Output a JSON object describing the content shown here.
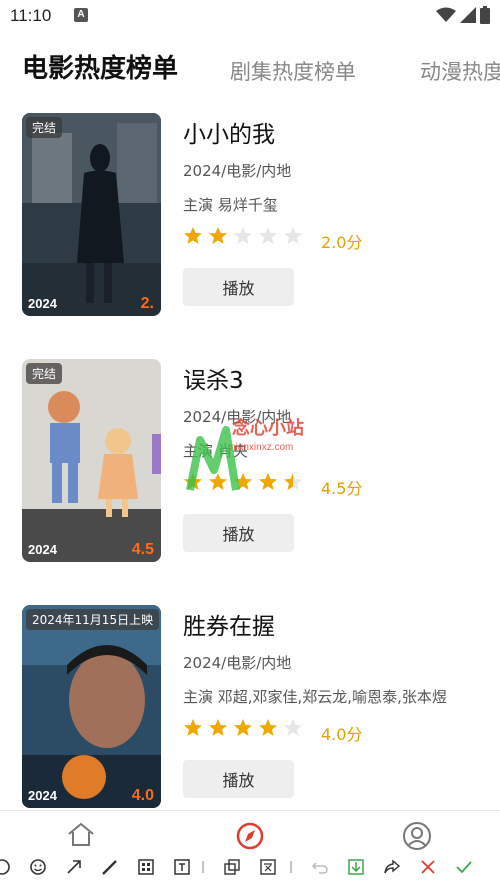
{
  "status_bar": {
    "time": "11:10",
    "badge": "A"
  },
  "tabs": [
    {
      "label": "电影热度榜单",
      "active": true
    },
    {
      "label": "剧集热度榜单",
      "active": false
    },
    {
      "label": "动漫热度",
      "active": false
    }
  ],
  "movies": [
    {
      "badge": "完结",
      "year": "2024",
      "score_mark": "2.",
      "title": "小小的我",
      "meta": "2024/电影/内地",
      "cast": "主演 易烊千玺",
      "stars": 2,
      "rating": "2.0分",
      "play_label": "播放"
    },
    {
      "badge": "完结",
      "year": "2024",
      "score_mark": "4.5",
      "title": "误杀3",
      "meta": "2024/电影/内地",
      "cast": "主演 肖央",
      "stars": 4.5,
      "rating": "4.5分",
      "play_label": "播放"
    },
    {
      "badge": "2024年11月15日上映",
      "year": "2024",
      "score_mark": "4.0",
      "title": "胜券在握",
      "meta": "2024/电影/内地",
      "cast": "主演 邓超,邓家佳,郑云龙,喻恩泰,张本煜",
      "stars": 4,
      "rating": "4.0分",
      "play_label": "播放"
    }
  ],
  "watermark": {
    "line1": "念心小站",
    "line2": "nianxinxz.com"
  },
  "colors": {
    "star_on": "#f0a800",
    "star_off": "#e6e6e6",
    "accent": "#e03c2e",
    "score_mark": "#ff6a14"
  }
}
